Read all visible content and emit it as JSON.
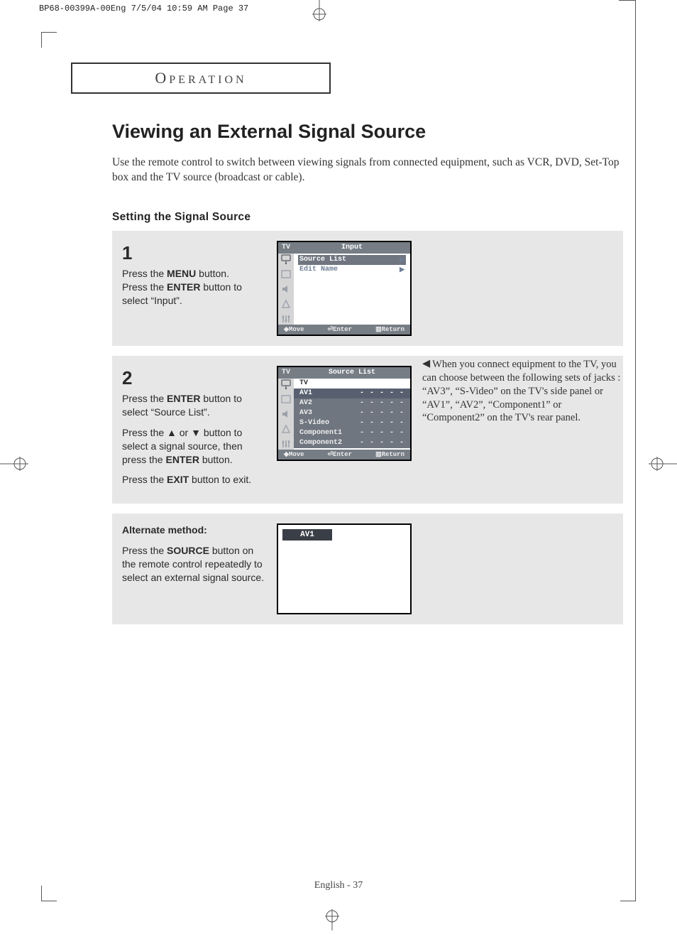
{
  "print_header": "BP68-00399A-00Eng  7/5/04  10:59 AM  Page 37",
  "section_tab": "OPERATION",
  "title": "Viewing an External Signal Source",
  "intro": "Use the remote control to switch between viewing signals from connected equipment, such as VCR, DVD, Set-Top box and the TV source (broadcast or cable).",
  "subhead": "Setting the Signal Source",
  "step1": {
    "num": "1",
    "line1a": "Press the ",
    "menu_b": "MENU",
    "line1b": " button.",
    "line2a": "Press the ",
    "enter_b": "ENTER",
    "line2b": " button to select “Input”."
  },
  "osd1": {
    "tv": "TV",
    "title": "Input",
    "rows": [
      {
        "label": "Source List",
        "arrow": "▶"
      },
      {
        "label": "Edit Name",
        "arrow": "▶"
      }
    ],
    "foot_move": "Move",
    "foot_enter": "Enter",
    "foot_return": "Return"
  },
  "step2": {
    "num": "2",
    "p1a": "Press the ",
    "p1_enter": "ENTER",
    "p1b": " button to select “Source List”.",
    "p2a": "Press the ▲ or ▼ button to select a signal source, then press the ",
    "p2_enter": "ENTER",
    "p2b": " button.",
    "p3a": "Press the ",
    "p3_exit": "EXIT",
    "p3b": " button to exit."
  },
  "osd2": {
    "tv": "TV",
    "title": "Source List",
    "tv_row": "TV",
    "rows": [
      {
        "label": "AV1",
        "value": "- - - - -",
        "hl": true
      },
      {
        "label": "AV2",
        "value": "- - - - -"
      },
      {
        "label": "AV3",
        "value": "- - - - -"
      },
      {
        "label": "S-Video",
        "value": "- - - - -"
      },
      {
        "label": "Component1",
        "value": "- - - - -"
      },
      {
        "label": "Component2",
        "value": "- - - - -"
      }
    ],
    "foot_move": "Move",
    "foot_enter": "Enter",
    "foot_return": "Return"
  },
  "side_note": "When you connect equipment to the TV, you can choose between the following sets of jacks : “AV3”, “S-Video” on the TV's side panel or “AV1”, “AV2”, “Component1” or “Component2” on the TV's rear panel.",
  "alt": {
    "head": "Alternate method:",
    "l1a": "Press the ",
    "source_b": "SOURCE",
    "l1b": " button on the remote control repeatedly to select an external signal source.",
    "banner": "AV1"
  },
  "footer": "English - 37"
}
